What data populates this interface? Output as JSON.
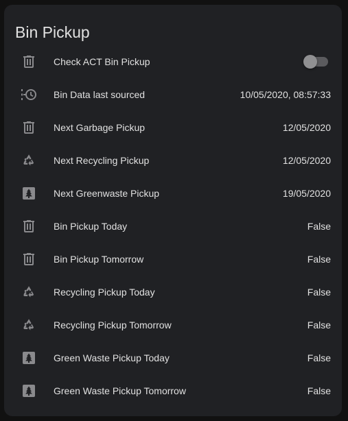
{
  "card": {
    "title": "Bin Pickup"
  },
  "rows": [
    {
      "icon": "trash-can-icon",
      "label": "Check ACT Bin Pickup",
      "type": "toggle",
      "state": "off"
    },
    {
      "icon": "clock-history-icon",
      "label": "Bin Data last sourced",
      "value": "10/05/2020, 08:57:33"
    },
    {
      "icon": "trash-can-icon",
      "label": "Next Garbage Pickup",
      "value": "12/05/2020"
    },
    {
      "icon": "recycle-icon",
      "label": "Next Recycling Pickup",
      "value": "12/05/2020"
    },
    {
      "icon": "pine-tree-box-icon",
      "label": "Next Greenwaste Pickup",
      "value": "19/05/2020"
    },
    {
      "icon": "trash-can-icon",
      "label": "Bin Pickup Today",
      "value": "False"
    },
    {
      "icon": "trash-can-icon",
      "label": "Bin Pickup Tomorrow",
      "value": "False"
    },
    {
      "icon": "recycle-icon",
      "label": "Recycling Pickup Today",
      "value": "False"
    },
    {
      "icon": "recycle-icon",
      "label": "Recycling Pickup Tomorrow",
      "value": "False"
    },
    {
      "icon": "pine-tree-box-icon",
      "label": "Green Waste Pickup Today",
      "value": "False"
    },
    {
      "icon": "pine-tree-box-icon",
      "label": "Green Waste Pickup Tomorrow",
      "value": "False"
    }
  ],
  "colors": {
    "background": "#111111",
    "card": "#202124",
    "text": "#e1e1e1",
    "icon": "#8a8a8d"
  }
}
